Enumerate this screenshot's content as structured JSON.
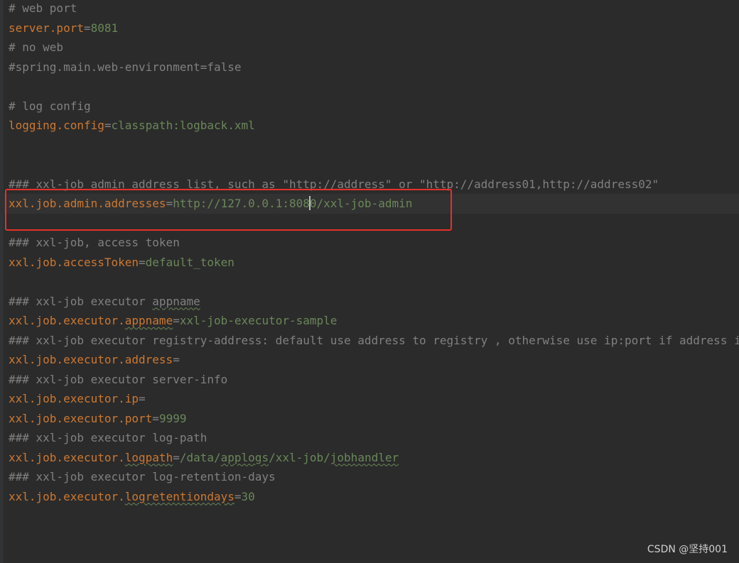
{
  "watermark": "CSDN @坚持001",
  "lines": [
    {
      "comment": "# web port"
    },
    {
      "key": "server.port",
      "value": "8081"
    },
    {
      "comment": "# no web"
    },
    {
      "comment": "#spring.main.web-environment=false"
    },
    {
      "blank": true
    },
    {
      "comment": "# log config"
    },
    {
      "key": "logging.config",
      "value": "classpath:logback.xml"
    },
    {
      "blank": true
    },
    {
      "blank": true
    },
    {
      "comment": "### xxl-job admin address list, such as \"http://address\" or \"http://address01,http://address02\""
    },
    {
      "key": "xxl.job.admin.addresses",
      "value_before_caret": "http://127.0.0.1:808",
      "value_after_caret": "0/xxl-job-admin",
      "current": true
    },
    {
      "blank": true
    },
    {
      "comment": "### xxl-job, access token"
    },
    {
      "key": "xxl.job.accessToken",
      "value": "default_token"
    },
    {
      "blank": true
    },
    {
      "comment_prefix": "### xxl-job executor ",
      "comment_sq": "appname"
    },
    {
      "key_prefix": "xxl.job.executor.",
      "key_sq": "appname",
      "value": "xxl-job-executor-sample"
    },
    {
      "comment": "### xxl-job executor registry-address: default use address to registry , otherwise use ip:port if address is null"
    },
    {
      "key": "xxl.job.executor.address",
      "value": ""
    },
    {
      "comment": "### xxl-job executor server-info"
    },
    {
      "key": "xxl.job.executor.ip",
      "value": ""
    },
    {
      "key": "xxl.job.executor.port",
      "value": "9999"
    },
    {
      "comment": "### xxl-job executor log-path"
    },
    {
      "key_prefix": "xxl.job.executor.",
      "key_sq": "logpath",
      "value_parts": [
        "/data/",
        "applogs",
        "/xxl-job/",
        "jobhandler"
      ],
      "value_sq": [
        false,
        true,
        false,
        true
      ]
    },
    {
      "comment": "### xxl-job executor log-retention-days"
    },
    {
      "key_prefix": "xxl.job.executor.",
      "key_sq": "logretentiondays",
      "value": "30"
    }
  ]
}
